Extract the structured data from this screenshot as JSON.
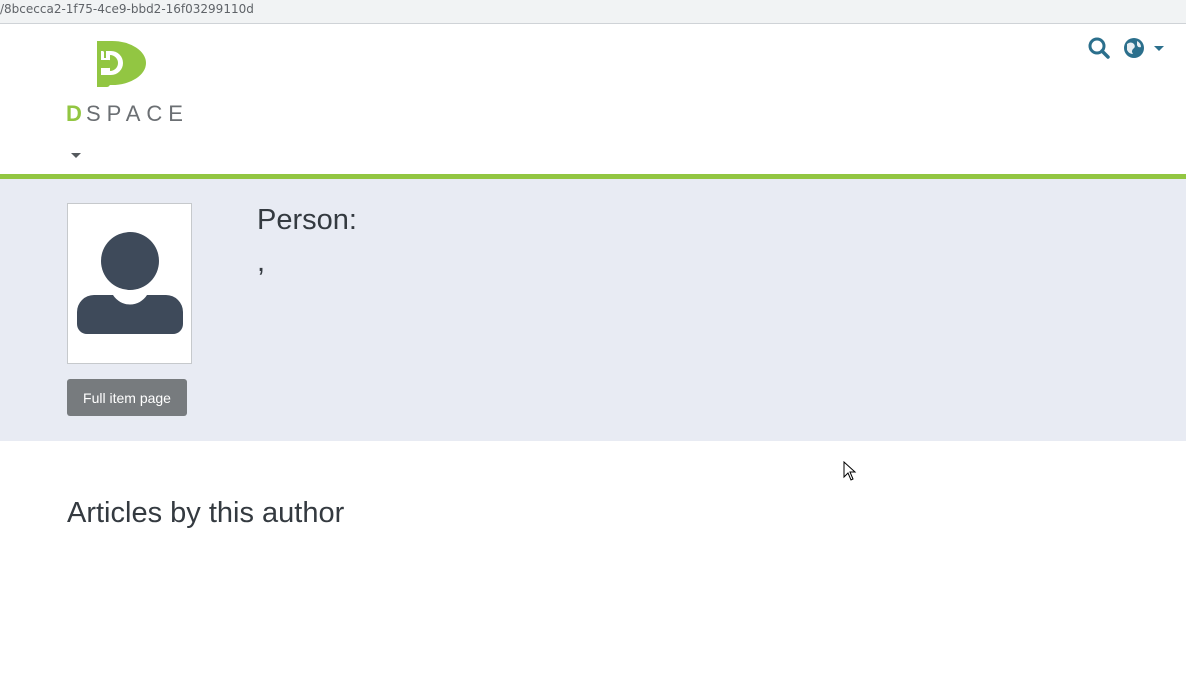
{
  "browser": {
    "url_fragment": "/8bcecca2-1f75-4ce9-bbd2-16f03299110d"
  },
  "header": {
    "logo_text": "DSPACE",
    "colors": {
      "brand_green": "#92c642",
      "brand_gray": "#6b6f73",
      "icon_blue": "#2b6f8c"
    },
    "icons": {
      "search": "search-icon",
      "language": "globe-icon",
      "nav_toggle": "caret-down-icon"
    }
  },
  "banner": {
    "label": "Person:",
    "name": ",",
    "full_item_button": "Full item page",
    "thumbnail_icon": "user-placeholder-icon"
  },
  "main": {
    "section_title": "Articles by this author"
  }
}
